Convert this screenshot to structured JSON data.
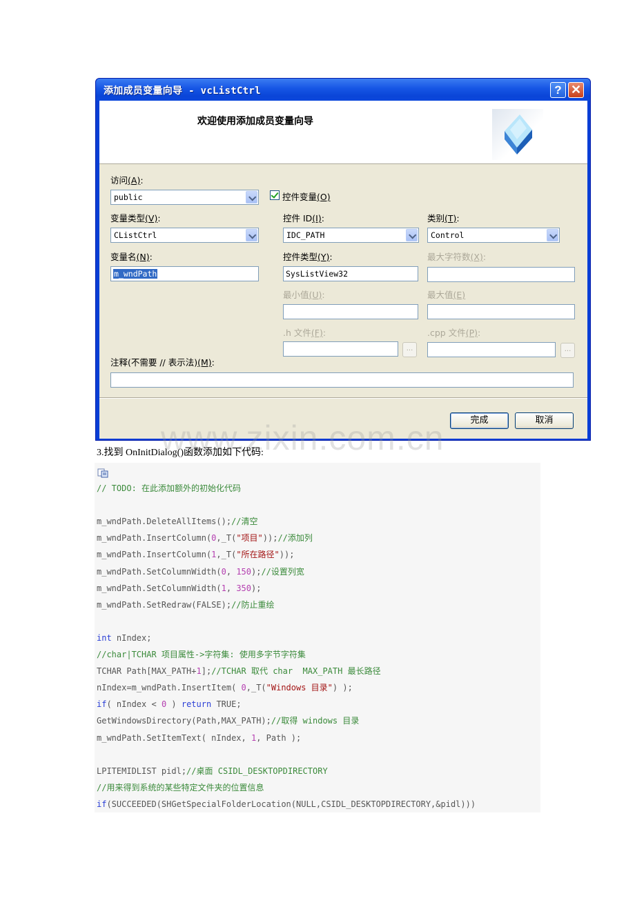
{
  "dialog": {
    "title": "添加成员变量向导 - vcListCtrl",
    "help_glyph": "?",
    "close_glyph": "✕",
    "header_title": "欢迎使用添加成员变量向导",
    "access": {
      "label": "访问",
      "mnemonic": "(A)",
      "colon": ":",
      "value": "public"
    },
    "control_var": {
      "label": "控件变量",
      "mnemonic": "(O)",
      "checked": true
    },
    "var_type": {
      "label": "变量类型",
      "mnemonic": "(V)",
      "colon": ":",
      "value": "CListCtrl"
    },
    "control_id": {
      "label": "控件 ID",
      "mnemonic": "(I)",
      "colon": ":",
      "value": "IDC_PATH"
    },
    "category": {
      "label": "类别",
      "mnemonic": "(T)",
      "colon": ":",
      "value": "Control"
    },
    "var_name": {
      "label": "变量名",
      "mnemonic": "(N)",
      "colon": ":",
      "value": "m_wndPath"
    },
    "control_type": {
      "label": "控件类型",
      "mnemonic": "(Y)",
      "colon": ":",
      "value": "SysListView32"
    },
    "max_chars": {
      "label": "最大字符数",
      "mnemonic": "(X)",
      "colon": ":",
      "value": ""
    },
    "min_value": {
      "label": "最小值",
      "mnemonic": "(U)",
      "colon": ":",
      "value": ""
    },
    "max_value": {
      "label": "最大值",
      "mnemonic": "(E)",
      "colon": "",
      "value": ""
    },
    "h_file": {
      "label": ".h 文件",
      "mnemonic": "(F)",
      "colon": ":",
      "value": ""
    },
    "cpp_file": {
      "label": ".cpp 文件",
      "mnemonic": "(P)",
      "colon": ":",
      "value": ""
    },
    "browse_glyph": "...",
    "comment": {
      "label": "注释(不需要 // 表示法)",
      "mnemonic": "(M)",
      "colon": ":",
      "value": ""
    },
    "finish_label": "完成",
    "cancel_label": "取消"
  },
  "watermark": "www.zixin.com.cn",
  "step_text": "3.找到 OnInitDialog()函数添加如下代码:",
  "code": {
    "icon": "copy-code-icon",
    "lines": [
      [
        [
          "// TODO: 在此添加额外的初始化代码",
          "c"
        ]
      ],
      [],
      [
        [
          "m_wndPath.DeleteAllItems();",
          ""
        ],
        [
          "//清空",
          "c"
        ]
      ],
      [
        [
          "m_wndPath.InsertColumn(",
          ""
        ],
        [
          "0",
          "n"
        ],
        [
          ",_T(",
          ""
        ],
        [
          "\"项目\"",
          "s"
        ],
        [
          "));",
          ""
        ],
        [
          "//添加列",
          "c"
        ]
      ],
      [
        [
          "m_wndPath.InsertColumn(",
          ""
        ],
        [
          "1",
          "n"
        ],
        [
          ",_T(",
          ""
        ],
        [
          "\"所在路径\"",
          "s"
        ],
        [
          "));",
          ""
        ]
      ],
      [
        [
          "m_wndPath.SetColumnWidth(",
          ""
        ],
        [
          "0",
          "n"
        ],
        [
          ", ",
          ""
        ],
        [
          "150",
          "n"
        ],
        [
          ");",
          ""
        ],
        [
          "//设置列宽",
          "c"
        ]
      ],
      [
        [
          "m_wndPath.SetColumnWidth(",
          ""
        ],
        [
          "1",
          "n"
        ],
        [
          ", ",
          ""
        ],
        [
          "350",
          "n"
        ],
        [
          ");",
          ""
        ]
      ],
      [
        [
          "m_wndPath.SetRedraw(FALSE);",
          ""
        ],
        [
          "//防止重绘",
          "c"
        ]
      ],
      [],
      [
        [
          "int",
          "k"
        ],
        [
          " nIndex;",
          ""
        ]
      ],
      [
        [
          "//char|TCHAR 项目属性->字符集: 使用多字节字符集",
          "c"
        ]
      ],
      [
        [
          "TCHAR Path[MAX_PATH+",
          ""
        ],
        [
          "1",
          "n"
        ],
        [
          "];",
          ""
        ],
        [
          "//TCHAR 取代 char  MAX_PATH 最长路径",
          "c"
        ]
      ],
      [
        [
          "nIndex=m_wndPath.InsertItem( ",
          ""
        ],
        [
          "0",
          "n"
        ],
        [
          ",_T(",
          ""
        ],
        [
          "\"Windows 目录\"",
          "s"
        ],
        [
          ") );",
          ""
        ]
      ],
      [
        [
          "if",
          "k"
        ],
        [
          "( nIndex < ",
          ""
        ],
        [
          "0",
          "n"
        ],
        [
          " ) ",
          ""
        ],
        [
          "return",
          "k"
        ],
        [
          " TRUE;",
          ""
        ]
      ],
      [
        [
          "GetWindowsDirectory(Path,MAX_PATH);",
          ""
        ],
        [
          "//取得 windows 目录",
          "c"
        ]
      ],
      [
        [
          "m_wndPath.SetItemText( nIndex, ",
          ""
        ],
        [
          "1",
          "n"
        ],
        [
          ", Path );",
          ""
        ]
      ],
      [],
      [
        [
          "LPITEMIDLIST pidl;",
          ""
        ],
        [
          "//桌面 CSIDL_DESKTOPDIRECTORY",
          "c"
        ]
      ],
      [
        [
          "//用来得到系统的某些特定文件夹的位置信息",
          "c"
        ]
      ],
      [
        [
          "if",
          "k"
        ],
        [
          "(SUCCEEDED(SHGetSpecialFolderLocation(NULL,CSIDL_DESKTOPDIRECTORY,&pidl)))",
          ""
        ]
      ]
    ]
  }
}
